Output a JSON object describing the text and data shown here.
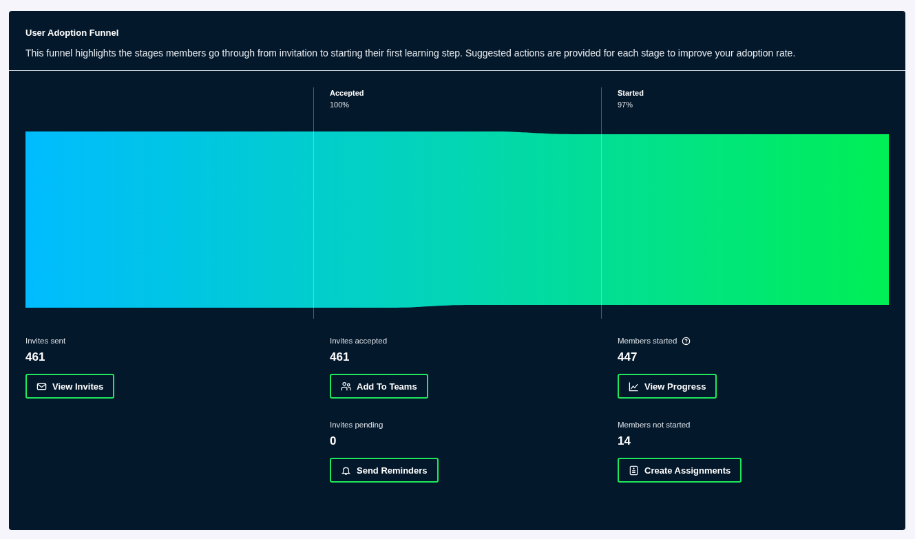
{
  "card": {
    "title": "User Adoption Funnel",
    "description": "This funnel highlights the stages members go through from invitation to starting their first learning step. Suggested actions are provided for each stage to improve your adoption rate."
  },
  "stages": [
    {
      "metrics": [
        {
          "label": "Invites sent",
          "value": "461",
          "help": false,
          "action": {
            "label": "View Invites",
            "kind": "mail"
          }
        }
      ]
    },
    {
      "label": "Accepted",
      "percent": "100%",
      "metrics": [
        {
          "label": "Invites accepted",
          "value": "461",
          "help": false,
          "action": {
            "label": "Add To Teams",
            "kind": "people"
          }
        },
        {
          "label": "Invites pending",
          "value": "0",
          "help": false,
          "action": {
            "label": "Send Reminders",
            "kind": "bell"
          }
        }
      ]
    },
    {
      "label": "Started",
      "percent": "97%",
      "metrics": [
        {
          "label": "Members started",
          "value": "447",
          "help": true,
          "action": {
            "label": "View Progress",
            "kind": "chart"
          }
        },
        {
          "label": "Members not started",
          "value": "14",
          "help": false,
          "action": {
            "label": "Create Assignments",
            "kind": "clipboard"
          }
        }
      ]
    }
  ]
}
